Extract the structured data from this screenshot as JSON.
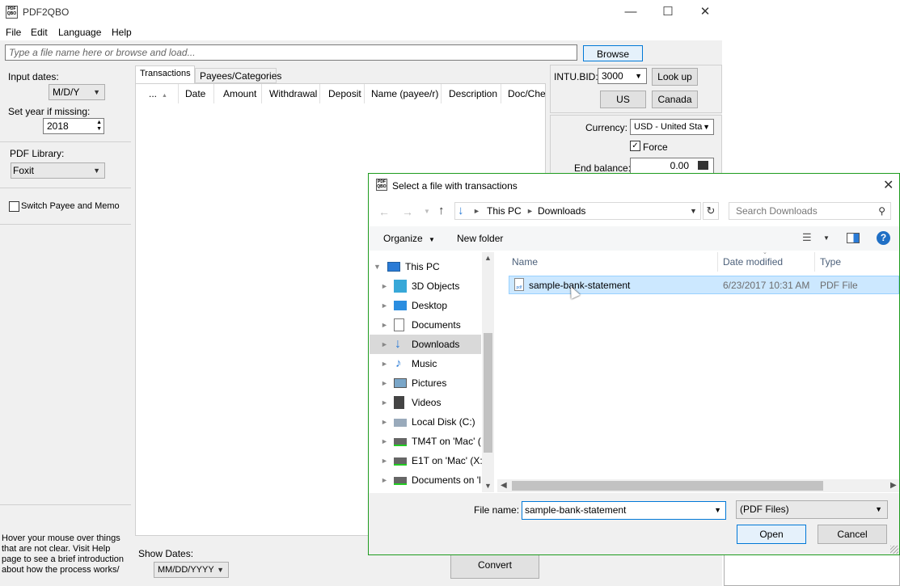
{
  "app": {
    "title": "PDF2QBO",
    "menu": [
      "File",
      "Edit",
      "Language",
      "Help"
    ],
    "file_placeholder": "Type a file name here or browse and load...",
    "browse_label": "Browse"
  },
  "left": {
    "input_dates_label": "Input dates:",
    "input_dates_value": "M/D/Y",
    "set_year_label": "Set year if missing:",
    "year_value": "2018",
    "pdf_library_label": "PDF Library:",
    "pdf_library_value": "Foxit",
    "switch_label": "Switch Payee and Memo",
    "hint": "Hover your mouse over things that are not clear. Visit Help page to see a brief introduction about how the process works/"
  },
  "tabs": [
    "Transactions",
    "Payees/Categories"
  ],
  "columns": [
    "...",
    "Date",
    "Amount",
    "Withdrawal",
    "Deposit",
    "Name (payee/r)",
    "Description",
    "Doc/Chec"
  ],
  "bottom": {
    "show_dates_label": "Show Dates:",
    "show_dates_value": "MM/DD/YYYY",
    "convert_label": "Convert"
  },
  "right": {
    "intu_label": "INTU.BID:",
    "intu_value": "3000",
    "lookup_label": "Look up",
    "us_label": "US",
    "canada_label": "Canada",
    "currency_label": "Currency:",
    "currency_value": "USD - United Sta",
    "force_label": "Force",
    "end_balance_label": "End balance:",
    "end_balance_value": "0.00"
  },
  "dialog": {
    "title": "Select a file with transactions",
    "path": [
      "This PC",
      "Downloads"
    ],
    "search_placeholder": "Search Downloads",
    "organize_label": "Organize",
    "new_folder_label": "New folder",
    "help_glyph": "?",
    "tree": [
      "This PC",
      "3D Objects",
      "Desktop",
      "Documents",
      "Downloads",
      "Music",
      "Pictures",
      "Videos",
      "Local Disk (C:)",
      "TM4T on 'Mac' (",
      "E1T on 'Mac' (X:",
      "Documents on 'l"
    ],
    "file_columns": [
      "Name",
      "Date modified",
      "Type"
    ],
    "files": [
      {
        "name": "sample-bank-statement",
        "date": "6/23/2017 10:31 AM",
        "type": "PDF File"
      }
    ],
    "filename_label": "File name:",
    "filename_value": "sample-bank-statement",
    "filter_value": "(PDF Files)",
    "open_label": "Open",
    "cancel_label": "Cancel"
  },
  "colors": {
    "dialog_border": "#1e9b1e",
    "selection": "#cce8ff",
    "accent_blue": "#0078d7"
  }
}
